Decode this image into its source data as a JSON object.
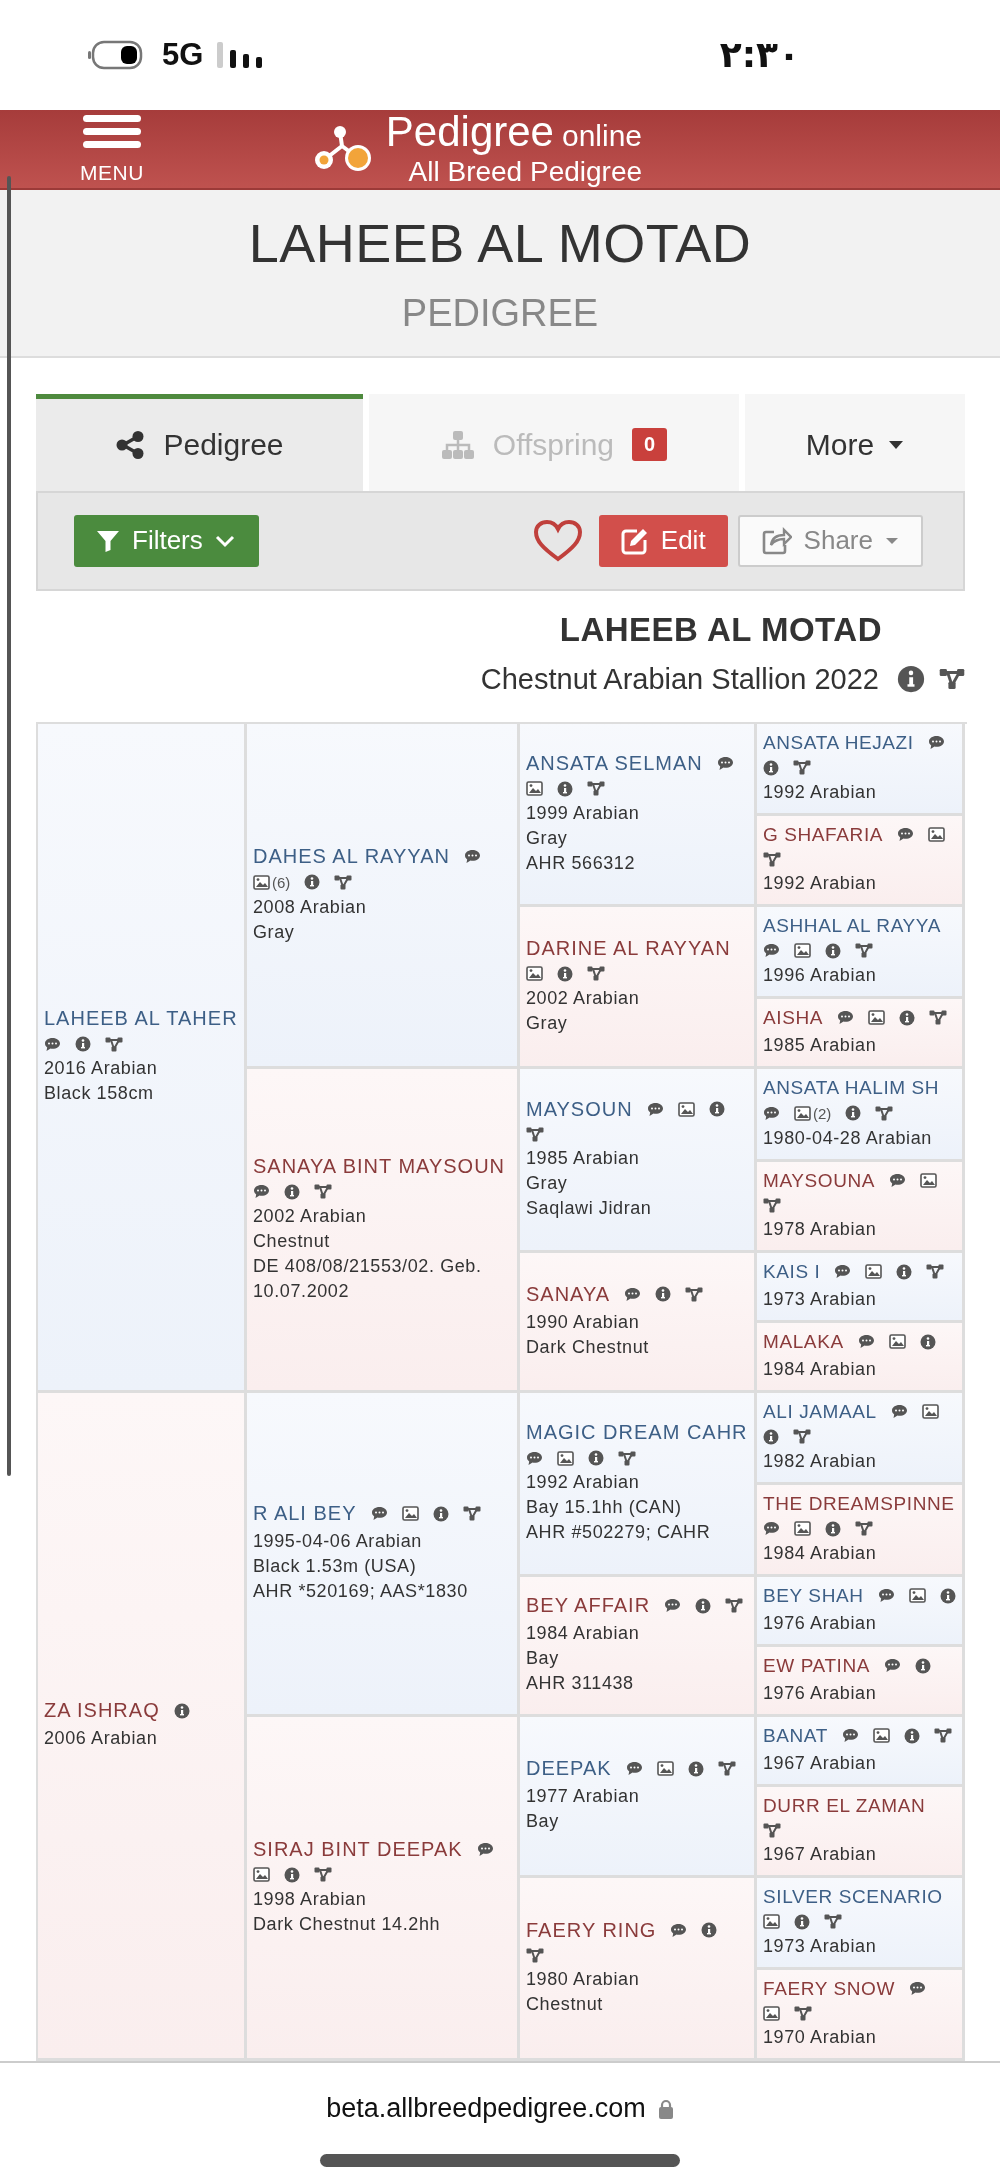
{
  "status_bar": {
    "network": "5G",
    "time": "٢:٣٠"
  },
  "header": {
    "menu_label": "MENU",
    "logo_title": "Pedigree",
    "logo_suffix": "online",
    "logo_subtitle": "All Breed Pedigree"
  },
  "title": {
    "name": "LAHEEB AL MOTAD",
    "subtitle": "PEDIGREE"
  },
  "tabs": [
    {
      "kind": "pedigree",
      "label": "Pedigree",
      "selected": true,
      "disabled": false
    },
    {
      "kind": "offspring",
      "label": "Offspring",
      "badge": "0",
      "selected": false,
      "disabled": true
    },
    {
      "kind": "dropdown",
      "label": "More",
      "selected": false,
      "disabled": false
    }
  ],
  "toolbar": {
    "buttons": [
      {
        "kind": "filter",
        "label": "Filters"
      },
      {
        "kind": "favorite"
      },
      {
        "kind": "edit",
        "label": "Edit"
      },
      {
        "kind": "share",
        "label": "Share"
      }
    ]
  },
  "horse": {
    "name": "LAHEEB AL MOTAD",
    "description": "Chestnut Arabian Stallion 2022"
  },
  "pedigree": [
    {
      "name": "LAHEEB AL TAHER",
      "kind": "sire",
      "icons": [
        {
          "kind": "comment"
        },
        {
          "kind": "info"
        },
        {
          "kind": "tree"
        }
      ],
      "details": [
        "2016 Arabian",
        "Black 158cm"
      ],
      "parents": [
        {
          "name": "DAHES AL RAYYAN",
          "kind": "sire",
          "icons": [
            {
              "kind": "comment"
            },
            {
              "kind": "photo",
              "count": "(6)"
            },
            {
              "kind": "info"
            },
            {
              "kind": "tree"
            }
          ],
          "details": [
            "2008 Arabian",
            "Gray"
          ],
          "parents": [
            {
              "name": "ANSATA SELMAN",
              "kind": "sire",
              "icons": [
                {
                  "kind": "comment"
                },
                {
                  "kind": "photo"
                },
                {
                  "kind": "info"
                },
                {
                  "kind": "tree"
                }
              ],
              "details": [
                "1999 Arabian",
                "Gray",
                "AHR 566312"
              ],
              "parents": [
                {
                  "name": "ANSATA HEJAZI",
                  "kind": "sire",
                  "icons": [
                    {
                      "kind": "comment"
                    },
                    {
                      "kind": "info"
                    },
                    {
                      "kind": "tree"
                    }
                  ],
                  "details": [
                    "1992 Arabian"
                  ]
                },
                {
                  "name": "G SHAFARIA",
                  "kind": "dam",
                  "icons": [
                    {
                      "kind": "comment"
                    },
                    {
                      "kind": "photo"
                    },
                    {
                      "kind": "tree"
                    }
                  ],
                  "details": [
                    "1992 Arabian"
                  ]
                }
              ]
            },
            {
              "name": "DARINE AL RAYYAN",
              "kind": "dam",
              "icons": [
                {
                  "kind": "photo"
                },
                {
                  "kind": "info"
                },
                {
                  "kind": "tree"
                }
              ],
              "details": [
                "2002 Arabian",
                "Gray"
              ],
              "parents": [
                {
                  "name": "ASHHAL AL RAYYA",
                  "kind": "sire",
                  "icons": [
                    {
                      "kind": "comment"
                    },
                    {
                      "kind": "photo"
                    },
                    {
                      "kind": "info"
                    },
                    {
                      "kind": "tree"
                    }
                  ],
                  "details": [
                    "1996 Arabian"
                  ]
                },
                {
                  "name": "AISHA",
                  "kind": "dam",
                  "icons": [
                    {
                      "kind": "comment"
                    },
                    {
                      "kind": "photo"
                    },
                    {
                      "kind": "info"
                    },
                    {
                      "kind": "tree"
                    }
                  ],
                  "details": [
                    "1985 Arabian"
                  ]
                }
              ]
            }
          ]
        },
        {
          "name": "SANAYA BINT MAYSOUN",
          "kind": "dam",
          "icons": [
            {
              "kind": "comment"
            },
            {
              "kind": "info"
            },
            {
              "kind": "tree"
            }
          ],
          "details": [
            "2002 Arabian",
            "Chestnut",
            "DE 408/08/21553/02. Geb. 10.07.2002"
          ],
          "parents": [
            {
              "name": "MAYSOUN",
              "kind": "sire",
              "icons": [
                {
                  "kind": "comment"
                },
                {
                  "kind": "photo"
                },
                {
                  "kind": "info"
                },
                {
                  "kind": "tree"
                }
              ],
              "details": [
                "1985 Arabian",
                "Gray",
                "Saqlawi Jidran"
              ],
              "parents": [
                {
                  "name": "ANSATA HALIM SH",
                  "kind": "sire",
                  "icons": [
                    {
                      "kind": "comment"
                    },
                    {
                      "kind": "photo",
                      "count": "(2)"
                    },
                    {
                      "kind": "info"
                    },
                    {
                      "kind": "tree"
                    }
                  ],
                  "details": [
                    "1980-04-28 Arabian"
                  ]
                },
                {
                  "name": "MAYSOUNA",
                  "kind": "dam",
                  "icons": [
                    {
                      "kind": "comment"
                    },
                    {
                      "kind": "photo"
                    },
                    {
                      "kind": "tree"
                    }
                  ],
                  "details": [
                    "1978 Arabian"
                  ]
                }
              ]
            },
            {
              "name": "SANAYA",
              "kind": "dam",
              "icons": [
                {
                  "kind": "comment"
                },
                {
                  "kind": "info"
                },
                {
                  "kind": "tree"
                }
              ],
              "details": [
                "1990 Arabian",
                "Dark Chestnut"
              ],
              "parents": [
                {
                  "name": "KAIS I",
                  "kind": "sire",
                  "icons": [
                    {
                      "kind": "comment"
                    },
                    {
                      "kind": "photo"
                    },
                    {
                      "kind": "info"
                    },
                    {
                      "kind": "tree"
                    }
                  ],
                  "details": [
                    "1973 Arabian"
                  ]
                },
                {
                  "name": "MALAKA",
                  "kind": "dam",
                  "icons": [
                    {
                      "kind": "comment"
                    },
                    {
                      "kind": "photo"
                    },
                    {
                      "kind": "info"
                    }
                  ],
                  "details": [
                    "1984 Arabian"
                  ]
                }
              ]
            }
          ]
        }
      ]
    },
    {
      "name": "ZA ISHRAQ",
      "kind": "dam",
      "icons": [
        {
          "kind": "info"
        }
      ],
      "details": [
        "2006 Arabian"
      ],
      "parents": [
        {
          "name": "R ALI BEY",
          "kind": "sire",
          "icons": [
            {
              "kind": "comment"
            },
            {
              "kind": "photo"
            },
            {
              "kind": "info"
            },
            {
              "kind": "tree"
            }
          ],
          "details": [
            "1995-04-06 Arabian",
            "Black 1.53m (USA)",
            "AHR *520169; AAS*1830"
          ],
          "parents": [
            {
              "name": "MAGIC DREAM CAHR",
              "kind": "sire",
              "icons": [
                {
                  "kind": "comment"
                },
                {
                  "kind": "photo"
                },
                {
                  "kind": "info"
                },
                {
                  "kind": "tree"
                }
              ],
              "details": [
                "1992 Arabian",
                "Bay 15.1hh (CAN)",
                "AHR #502279; CAHR"
              ],
              "parents": [
                {
                  "name": "ALI JAMAAL",
                  "kind": "sire",
                  "icons": [
                    {
                      "kind": "comment"
                    },
                    {
                      "kind": "photo"
                    },
                    {
                      "kind": "info"
                    },
                    {
                      "kind": "tree"
                    }
                  ],
                  "details": [
                    "1982 Arabian"
                  ]
                },
                {
                  "name": "THE DREAMSPINNE",
                  "kind": "dam",
                  "icons": [
                    {
                      "kind": "comment"
                    },
                    {
                      "kind": "photo"
                    },
                    {
                      "kind": "info"
                    },
                    {
                      "kind": "tree"
                    }
                  ],
                  "details": [
                    "1984 Arabian"
                  ]
                }
              ]
            },
            {
              "name": "BEY AFFAIR",
              "kind": "dam",
              "icons": [
                {
                  "kind": "comment"
                },
                {
                  "kind": "info"
                },
                {
                  "kind": "tree"
                }
              ],
              "details": [
                "1984 Arabian",
                "Bay",
                "AHR 311438"
              ],
              "parents": [
                {
                  "name": "BEY SHAH",
                  "kind": "sire",
                  "icons": [
                    {
                      "kind": "comment"
                    },
                    {
                      "kind": "photo"
                    },
                    {
                      "kind": "info"
                    }
                  ],
                  "details": [
                    "1976 Arabian"
                  ]
                },
                {
                  "name": "EW PATINA",
                  "kind": "dam",
                  "icons": [
                    {
                      "kind": "comment"
                    },
                    {
                      "kind": "info"
                    }
                  ],
                  "details": [
                    "1976 Arabian"
                  ]
                }
              ]
            }
          ]
        },
        {
          "name": "SIRAJ BINT DEEPAK",
          "kind": "dam",
          "icons": [
            {
              "kind": "comment"
            },
            {
              "kind": "photo"
            },
            {
              "kind": "info"
            },
            {
              "kind": "tree"
            }
          ],
          "details": [
            "1998 Arabian",
            "Dark Chestnut 14.2hh"
          ],
          "parents": [
            {
              "name": "DEEPAK",
              "kind": "sire",
              "icons": [
                {
                  "kind": "comment"
                },
                {
                  "kind": "photo"
                },
                {
                  "kind": "info"
                },
                {
                  "kind": "tree"
                }
              ],
              "details": [
                "1977 Arabian",
                "Bay"
              ],
              "parents": [
                {
                  "name": "BANAT",
                  "kind": "sire",
                  "icons": [
                    {
                      "kind": "comment"
                    },
                    {
                      "kind": "photo"
                    },
                    {
                      "kind": "info"
                    },
                    {
                      "kind": "tree"
                    }
                  ],
                  "details": [
                    "1967 Arabian"
                  ]
                },
                {
                  "name": "DURR EL ZAMAN",
                  "kind": "dam",
                  "icons": [
                    {
                      "kind": "tree"
                    }
                  ],
                  "details": [
                    "1967 Arabian"
                  ]
                }
              ]
            },
            {
              "name": "FAERY RING",
              "kind": "dam",
              "icons": [
                {
                  "kind": "comment"
                },
                {
                  "kind": "info"
                },
                {
                  "kind": "tree"
                }
              ],
              "details": [
                "1980 Arabian",
                "Chestnut"
              ],
              "parents": [
                {
                  "name": "SILVER SCENARIO",
                  "kind": "sire",
                  "icons": [
                    {
                      "kind": "photo"
                    },
                    {
                      "kind": "info"
                    },
                    {
                      "kind": "tree"
                    }
                  ],
                  "details": [
                    "1973 Arabian"
                  ]
                },
                {
                  "name": "FAERY SNOW",
                  "kind": "dam",
                  "icons": [
                    {
                      "kind": "comment"
                    },
                    {
                      "kind": "photo"
                    },
                    {
                      "kind": "tree"
                    }
                  ],
                  "details": [
                    "1970 Arabian"
                  ]
                }
              ]
            }
          ]
        }
      ]
    }
  ],
  "address_bar": {
    "url": "beta.allbreedpedigree.com"
  }
}
